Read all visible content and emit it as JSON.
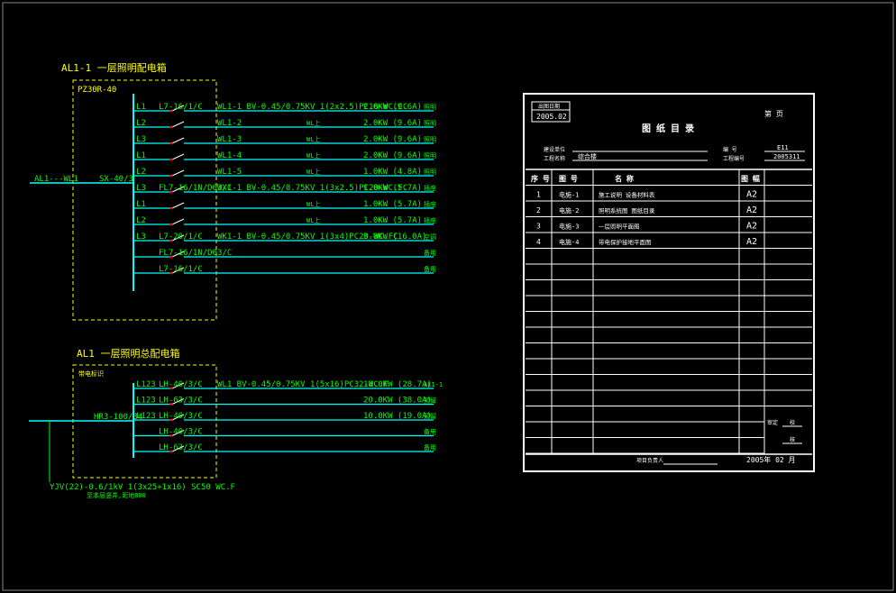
{
  "panel1": {
    "title": "AL1-1  一层照明配电箱",
    "breaker_label": "PZ30R-40",
    "incoming_label": "AL1---WL1",
    "main_switch": "SX-40/3",
    "circuits": [
      {
        "phase": "L1",
        "breaker": "L7-16/1/C",
        "cable": "WL1-1  BV-0.45/0.75KV 1(2x2.5)PC16-WC.CC",
        "load": "2.0KW (9.6A)",
        "use": "照明"
      },
      {
        "phase": "L2",
        "breaker": "",
        "cable": "WL1-2",
        "dup": "WL上",
        "load": "2.0KW (9.6A)",
        "use": "照明"
      },
      {
        "phase": "L3",
        "breaker": "",
        "cable": "WL1-3",
        "dup": "WL上",
        "load": "2.0KW (9.6A)",
        "use": "照明"
      },
      {
        "phase": "L1",
        "breaker": "",
        "cable": "WL1-4",
        "dup": "WL上",
        "load": "2.0KW (9.6A)",
        "use": "照明"
      },
      {
        "phase": "L2",
        "breaker": "",
        "cable": "WL1-5",
        "dup": "WL上",
        "load": "1.0KW (4.8A)",
        "use": "照明"
      },
      {
        "phase": "L3",
        "breaker": "FL7-16/1N/D03/C",
        "cable": "WX1-1  BV-0.45/0.75KV 1(3x2.5)PC20-WC.FC",
        "load": "1.0KW (5.7A)",
        "use": "插座"
      },
      {
        "phase": "L1",
        "breaker": "",
        "cable": "",
        "dup": "WL上",
        "load": "1.0KW (5.7A)",
        "use": "插座"
      },
      {
        "phase": "L2",
        "breaker": "",
        "cable": "",
        "dup": "WL上",
        "load": "1.0KW (5.7A)",
        "use": "插座"
      },
      {
        "phase": "L3",
        "breaker": "L7-20/1/C",
        "cable": "WK1-1  BV-0.45/0.75KV 1(3x4)PC20-WC.FC",
        "load": "3.0KW (16.0A)",
        "use": "空调"
      },
      {
        "phase": "",
        "breaker": "FL7-16/1N/D03/C",
        "cable": "",
        "load": "",
        "use": "备用"
      },
      {
        "phase": "",
        "breaker": "L7-16/1/C",
        "cable": "",
        "load": "",
        "use": "备用"
      }
    ]
  },
  "panel2": {
    "title": "AL1  一层照明总配电箱",
    "box_note": "带电标识",
    "main_switch": "HR3-100/34",
    "incoming_cable": "YJV(22)-0.6/1kV 1(3x25+1x16) SC50 WC.F",
    "incoming_note": "至本层竖井,距地800",
    "circuits": [
      {
        "phase": "L123",
        "breaker": "LH-40/3/C",
        "cable": "WL1  BV-0.45/0.75KV 1(5x16)PC32-WC.F",
        "load": "18.0KW (28.7A)",
        "use": "AL1-1"
      },
      {
        "phase": "L123",
        "breaker": "LH-63/3/C",
        "cable": "",
        "load": "20.0KW (38.0A)",
        "use": "预留"
      },
      {
        "phase": "L123",
        "breaker": "LH-40/3/C",
        "cable": "",
        "load": "10.0KW (19.0A)",
        "use": "预留"
      },
      {
        "phase": "",
        "breaker": "LH-40/3/C",
        "cable": "",
        "load": "",
        "use": "备用"
      },
      {
        "phase": "",
        "breaker": "LH-63/3/C",
        "cable": "",
        "load": "",
        "use": "备用"
      }
    ]
  },
  "sheet": {
    "date_label": "出图日期",
    "date_value": "2005.02",
    "page_label": "第    页",
    "title": "图 纸 目 录",
    "client_label": "建设单位",
    "project_label": "工程名称",
    "project_value": "综合楼",
    "no_label": "编    号",
    "no_value": "E11",
    "proj_no_label": "工程编号",
    "proj_no_value": "2005311",
    "headers": [
      "序 号",
      "图  号",
      "名          称",
      "图 幅",
      ""
    ],
    "rows": [
      {
        "n": "1",
        "code": "电施-1",
        "name": "施工说明  设备材料表",
        "size": "A2"
      },
      {
        "n": "2",
        "code": "电施-2",
        "name": "照明系统图  图纸目录",
        "size": "A2"
      },
      {
        "n": "3",
        "code": "电施-3",
        "name": "一层照明平面图",
        "size": "A2"
      },
      {
        "n": "4",
        "code": "电施-4",
        "name": "带电保护接地平面图",
        "size": "A2"
      }
    ],
    "side_label1": "审定",
    "side_label2": "校",
    "side_label3": "核",
    "footer_label": "项目负责人",
    "footer_date": "2005年 02 月"
  },
  "colors": {
    "green": "#00ff00",
    "cyan": "#00ffff",
    "yellow": "#ffff00",
    "white": "#ffffff",
    "red": "#ff0000",
    "blue": "#3366ff"
  }
}
